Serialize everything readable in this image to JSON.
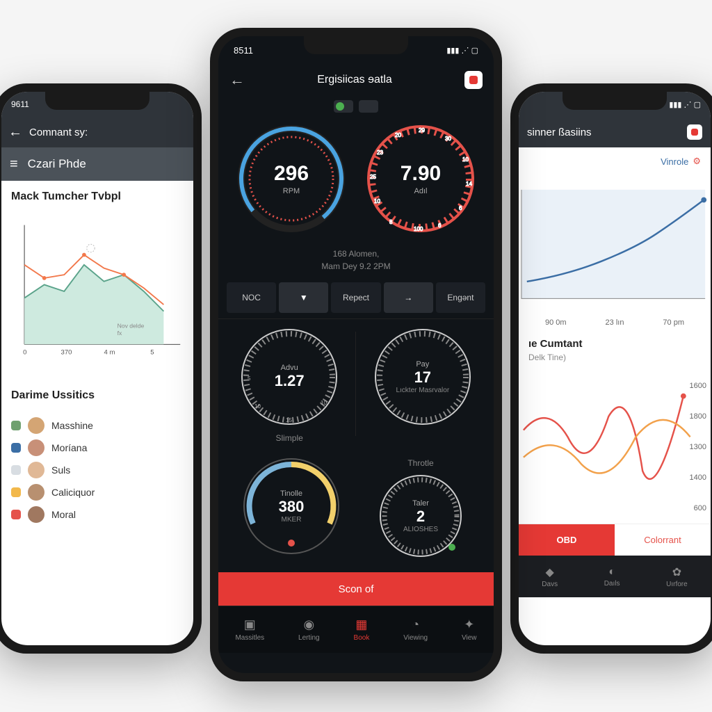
{
  "left_phone": {
    "status_time": "9611",
    "header_title": "Comnant sy:",
    "sub_header": "Czari Phde",
    "chart_title": "Mack Tumcher Tvbpl",
    "chart_xnote": "Nov delde fx",
    "chart_x": [
      "0",
      "370",
      "4m",
      "5"
    ],
    "legend_title": "Darime Ussitics",
    "legend": [
      {
        "swatch": "#6fa06f",
        "label": "Masshine"
      },
      {
        "swatch": "#3b6ea5",
        "label": "Moríana"
      },
      {
        "swatch": "#d8dde2",
        "label": "Suls"
      },
      {
        "swatch": "#f2b84b",
        "label": "Caliciquor"
      },
      {
        "swatch": "#e5524a",
        "label": "Moral"
      }
    ]
  },
  "center_phone": {
    "status_time": "8511",
    "header_title": "Ergisiicas ɘatla",
    "gauge_left": {
      "value": "296",
      "unit": "RPM"
    },
    "gauge_right": {
      "value": "7.90",
      "unit": "Adıl"
    },
    "meta_line1": "168 Alomen,",
    "meta_line2": "Mam Dey 9.2 2PM",
    "tabs": [
      "NOC",
      "",
      "Repect",
      "",
      "Engənt"
    ],
    "mid_left": {
      "t1": "Advu",
      "t2": "1.27",
      "label": "Slimple"
    },
    "mid_right": {
      "t1": "Pay",
      "t2": "17",
      "t3": "Lıckter Masrvalor"
    },
    "bot_left": {
      "t1": "Tinolle",
      "t2": "380",
      "t3": "MKER"
    },
    "bot_right": {
      "t1": "Taler",
      "t2": "2",
      "t3": "ALIOSHES"
    },
    "label_throtle": "Throtle",
    "scan_label": "Scon of",
    "nav": [
      {
        "icon": "▣",
        "label": "Massitles"
      },
      {
        "icon": "◉",
        "label": "Lerting"
      },
      {
        "icon": "▦",
        "label": "Book"
      },
      {
        "icon": "◔",
        "label": "Viewing"
      },
      {
        "icon": "✦",
        "label": "View"
      }
    ]
  },
  "right_phone": {
    "header_title": "sinner ßasiins",
    "legend_top_label": "Vinrole",
    "chart1_x": [
      "90 0m",
      "23 lın",
      "70 pm"
    ],
    "section_title": "ıe Cumtant",
    "section_sub": "Delk Tine)",
    "chart2_y": [
      "1600",
      "1800",
      "1300",
      "1400",
      "600"
    ],
    "tabs": [
      "OBD",
      "Colorrant"
    ],
    "nav": [
      {
        "icon": "◆",
        "label": "Davs"
      },
      {
        "icon": "◐",
        "label": "Daıls"
      },
      {
        "icon": "✿",
        "label": "Uırfore"
      }
    ]
  },
  "chart_data": [
    {
      "id": "left_area_chart",
      "type": "area",
      "title": "Mack Tumcher Tvbpl",
      "x": [
        0,
        1,
        2,
        3,
        4,
        5,
        6,
        7
      ],
      "series": [
        {
          "name": "green",
          "color": "#78c2a4",
          "values": [
            35,
            40,
            38,
            48,
            44,
            46,
            40,
            30
          ]
        },
        {
          "name": "orange",
          "color": "#f2784b",
          "values": [
            65,
            55,
            58,
            70,
            62,
            58,
            50,
            40
          ]
        }
      ],
      "xticks": [
        "0",
        "370",
        "4m",
        "5"
      ],
      "annotation": "Nov delde fx"
    },
    {
      "id": "right_line_chart",
      "type": "line",
      "x": [
        0,
        1,
        2,
        3,
        4
      ],
      "series": [
        {
          "name": "Vinrole",
          "color": "#3b6ea5",
          "values": [
            20,
            28,
            35,
            50,
            72
          ]
        }
      ],
      "xticks": [
        "90 0m",
        "23 lın",
        "70 pm"
      ]
    },
    {
      "id": "right_curve_chart",
      "type": "line",
      "title": "ıe Cumtant",
      "x": [
        0,
        1,
        2,
        3,
        4,
        5,
        6
      ],
      "series": [
        {
          "name": "red",
          "color": "#e5524a",
          "values": [
            1400,
            1500,
            1350,
            1550,
            1300,
            900,
            1600
          ]
        },
        {
          "name": "orange",
          "color": "#f2a14b",
          "values": [
            1200,
            1350,
            1250,
            1400,
            1200,
            1400,
            1400
          ]
        }
      ],
      "ylim": [
        600,
        1800
      ],
      "yticks": [
        1600,
        1800,
        1300,
        1400,
        600
      ]
    }
  ]
}
